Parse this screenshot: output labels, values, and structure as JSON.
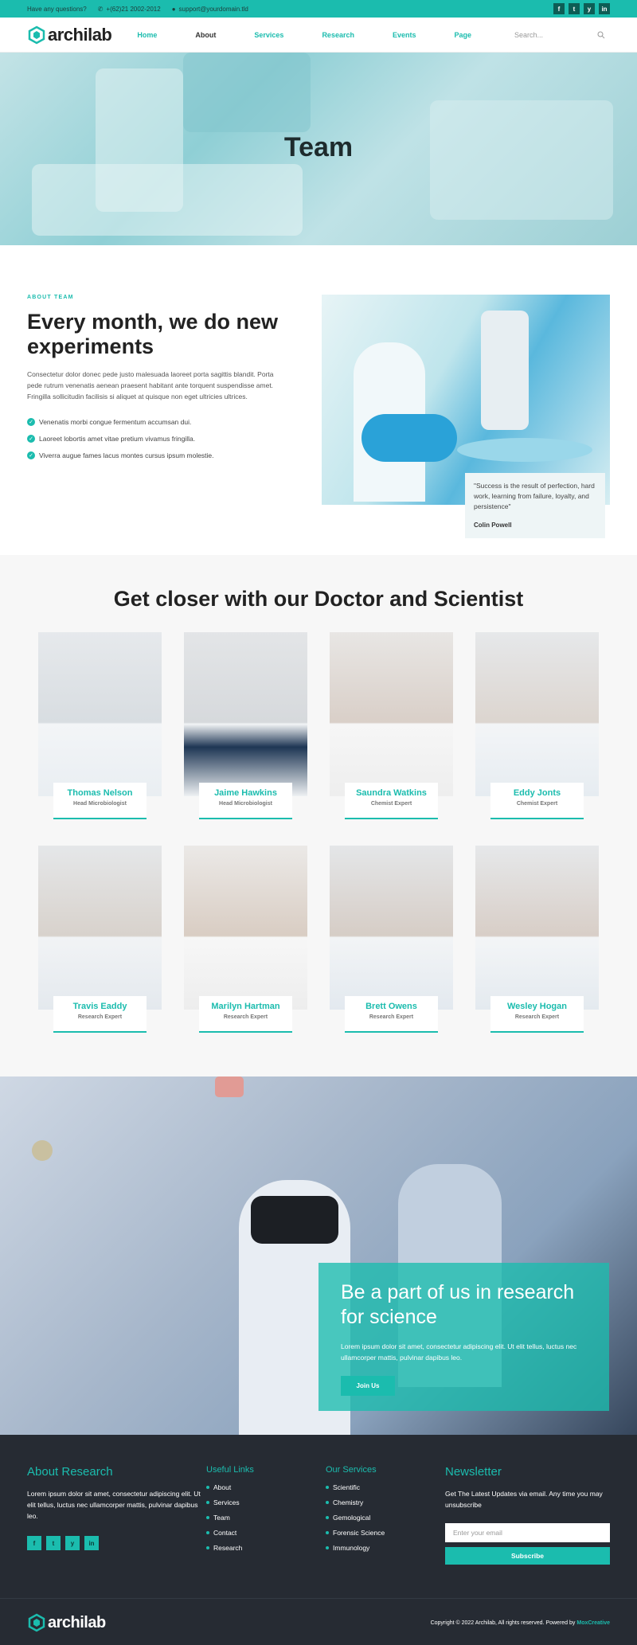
{
  "topbar": {
    "question": "Have any questions?",
    "phone": "+(62)21 2002-2012",
    "email": "support@yourdomain.tld",
    "socials": [
      "f",
      "t",
      "y",
      "in"
    ]
  },
  "nav": {
    "logo": "archilab",
    "items": [
      "Home",
      "About",
      "Services",
      "Research",
      "Events",
      "Page"
    ],
    "search_placeholder": "Search..."
  },
  "hero": {
    "title": "Team"
  },
  "about": {
    "eyebrow": "ABOUT TEAM",
    "title": "Every month, we do new experiments",
    "text": "Consectetur dolor donec pede justo malesuada laoreet porta sagittis blandit. Porta pede rutrum venenatis aenean praesent habitant ante torquent suspendisse amet. Fringilla sollicitudin facilisis si aliquet at quisque non eget ultricies ultrices.",
    "checks": [
      "Venenatis morbi congue fermentum accumsan dui.",
      "Laoreet lobortis amet vitae pretium vivamus fringilla.",
      "Viverra augue fames lacus montes cursus ipsum molestie."
    ],
    "quote": "\"Success is the result of perfection, hard work, learning from failure, loyalty, and persistence\"",
    "quote_author": "Colin Powell"
  },
  "team": {
    "title": "Get closer with our Doctor and Scientist",
    "members": [
      {
        "name": "Thomas Nelson",
        "role": "Head Microbiologist"
      },
      {
        "name": "Jaime Hawkins",
        "role": "Head Microbiologist"
      },
      {
        "name": "Saundra Watkins",
        "role": "Chemist Expert"
      },
      {
        "name": "Eddy Jonts",
        "role": "Chemist Expert"
      },
      {
        "name": "Travis Eaddy",
        "role": "Research Expert"
      },
      {
        "name": "Marilyn Hartman",
        "role": "Research Expert"
      },
      {
        "name": "Brett Owens",
        "role": "Research Expert"
      },
      {
        "name": "Wesley Hogan",
        "role": "Research Expert"
      }
    ]
  },
  "cta": {
    "title": "Be a part of us in research for science",
    "text": "Lorem ipsum dolor sit amet, consectetur adipiscing elit. Ut elit tellus, luctus nec ullamcorper mattis, pulvinar dapibus leo.",
    "button": "Join Us"
  },
  "footer": {
    "about_title": "About Research",
    "about_text": "Lorem ipsum dolor sit amet, consectetur adipiscing elit. Ut elit tellus, luctus nec ullamcorper mattis, pulvinar dapibus leo.",
    "links_title": "Useful Links",
    "links": [
      "About",
      "Services",
      "Team",
      "Contact",
      "Research"
    ],
    "services_title": "Our Services",
    "services": [
      "Scientific",
      "Chemistry",
      "Gemological",
      "Forensic Science",
      "Immunology"
    ],
    "newsletter_title": "Newsletter",
    "newsletter_text": "Get The Latest Updates via email. Any time you may unsubscribe",
    "email_placeholder": "Enter your email",
    "subscribe": "Subscribe",
    "copyright": "Copyright © 2022 Archilab, All rights reserved. Powered by",
    "brand": "MoxCreative"
  },
  "colors": {
    "accent": "#1bbcae",
    "footer": "#262b33"
  }
}
